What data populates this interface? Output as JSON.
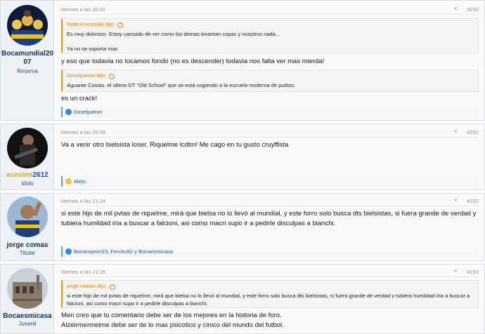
{
  "posts": [
    {
      "username": "Bocamundial2007",
      "username_line1": "Bocamundial20",
      "username_line2": "07",
      "rank": "Reserva",
      "time": "Viernes a las 20:01",
      "number": "#230",
      "quotes": [
        {
          "author": "FedeXeneize84 dijo:",
          "lines": [
            "Es muy doloroso. Estoy cansado de ver como los demas levantan copas y nosotros nada...",
            "",
            "Ya no se soporta mas"
          ]
        }
      ],
      "text_after_quote1": "y eso que todavia no tocamos fondo (no es descender) todavia nos falta ver mas mierda!",
      "quote2": {
        "author": "Doselpatron dijo:",
        "text": "Aguante Costas. el ultimo DT \"Old School\" que se está cogiendo a la escuela moderna de putitos."
      },
      "text_after_quote2": "es un crack!",
      "reactions": "Doselpatron"
    },
    {
      "username": "asesino2612",
      "username_part1": "asesino",
      "username_part2": "2612",
      "rank": "Idolo",
      "time": "Viernes a las 20:58",
      "number": "#231",
      "text": "Va a venir otro bielsista loser. Riquelme lcdtm! Me cago en tu gusto cruyffista",
      "reactions": "Alejo."
    },
    {
      "username": "jorge comas",
      "rank": "Titular",
      "time": "Viernes a las 21:24",
      "number": "#232",
      "text": "si este hijo de mil pvtas de riquelme, mirá que bielsa no lo llevó al mundial, y este forro solo busca dts bielsistas, si fuera grande de verdad y tubiera humildad iría a buscar a falcioni, asi como macri supo ir a pedirle disculpas a bianchi.",
      "reactions": "Bocampeon23, Ferchu92 y Bocaesmicasa"
    },
    {
      "username": "Bocaesmicasa",
      "rank": "Juvenil",
      "time": "Viernes a las 21:26",
      "number": "#233",
      "quote": {
        "author": "jorge comas dijo:",
        "text": "si este hijo de mil pvtas de riquelme, mirá que bielsa no lo llevó al mundial, y este forro solo busca dts bielsistas, si fuera grande de verdad y tubiera humildad iría a buscar a falcioni, asi como macri supo ir a pedirle disculpas a bianchi."
      },
      "text_lines": [
        "Men creo que tu comentario debe ser de los mejores en la historia de foro.",
        "Alzeirmermelme debe ser de lo mas psicotico y cinico del mundo del futbol."
      ]
    }
  ],
  "icons": {
    "share": "share-icon",
    "quote_arrow": "up-arrow-icon",
    "like": "like-icon",
    "haha": "haha-icon"
  },
  "colors": {
    "quote_author": "#e0820b",
    "username": "#15304a",
    "asesino_yellow": "#d4b000",
    "reaction_bar": "#47a7eb"
  }
}
